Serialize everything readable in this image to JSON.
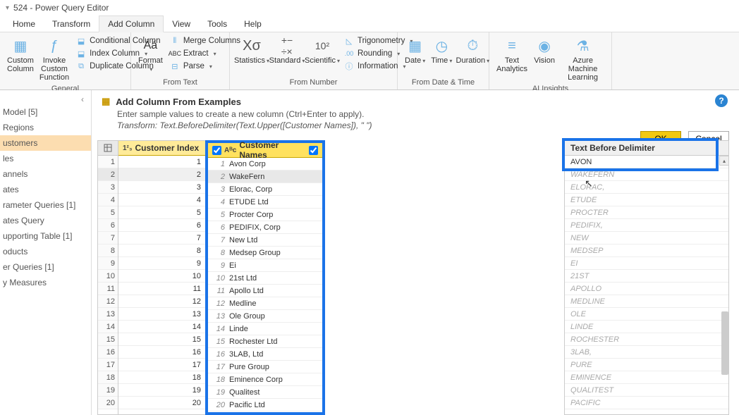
{
  "window_title": "524 - Power Query Editor",
  "menu": [
    "Home",
    "Transform",
    "Add Column",
    "View",
    "Tools",
    "Help"
  ],
  "active_menu": 2,
  "ribbon": {
    "general": {
      "label": "General",
      "custom_column": "Custom\nColumn",
      "invoke": "Invoke Custom\nFunction",
      "conditional": "Conditional Column",
      "index": "Index Column",
      "duplicate": "Duplicate Column"
    },
    "from_text": {
      "label": "From Text",
      "format": "Format",
      "merge": "Merge Columns",
      "extract": "Extract",
      "parse": "Parse"
    },
    "from_number": {
      "label": "From Number",
      "statistics": "Statistics",
      "standard": "Standard",
      "scientific": "Scientific",
      "trig": "Trigonometry",
      "rounding": "Rounding",
      "information": "Information"
    },
    "from_date": {
      "label": "From Date & Time",
      "date": "Date",
      "time": "Time",
      "duration": "Duration"
    },
    "ai": {
      "label": "AI Insights",
      "text_analytics": "Text\nAnalytics",
      "vision": "Vision",
      "azure_ml": "Azure Machine\nLearning"
    }
  },
  "queries": {
    "items": [
      "Model [5]",
      "Regions",
      "ustomers",
      "les",
      "annels",
      "ates",
      "rameter Queries [1]",
      "ates Query",
      "upporting Table [1]",
      "oducts",
      "er Queries [1]",
      "y Measures"
    ],
    "selected_index": 2
  },
  "banner": {
    "title": "Add Column From Examples",
    "subtitle": "Enter sample values to create a new column (Ctrl+Enter to apply).",
    "transform": "Transform: Text.BeforeDelimiter(Text.Upper([Customer Names]), \" \")",
    "ok": "OK",
    "cancel": "Cancel"
  },
  "grid": {
    "col_index": "Customer Index",
    "col_names": "Customer Names",
    "result_header": "Text Before Delimiter",
    "rows": [
      {
        "n": 1,
        "name": "Avon Corp",
        "out": "AVON",
        "filled": true
      },
      {
        "n": 2,
        "name": "WakeFern",
        "out": "WAKEFERN"
      },
      {
        "n": 3,
        "name": "Elorac, Corp",
        "out": "ELORAC,"
      },
      {
        "n": 4,
        "name": "ETUDE Ltd",
        "out": "ETUDE"
      },
      {
        "n": 5,
        "name": "Procter Corp",
        "out": "PROCTER"
      },
      {
        "n": 6,
        "name": "PEDIFIX, Corp",
        "out": "PEDIFIX,"
      },
      {
        "n": 7,
        "name": "New Ltd",
        "out": "NEW"
      },
      {
        "n": 8,
        "name": "Medsep Group",
        "out": "MEDSEP"
      },
      {
        "n": 9,
        "name": "Ei",
        "out": "EI"
      },
      {
        "n": 10,
        "name": "21st Ltd",
        "out": "21ST"
      },
      {
        "n": 11,
        "name": "Apollo Ltd",
        "out": "APOLLO"
      },
      {
        "n": 12,
        "name": "Medline",
        "out": "MEDLINE"
      },
      {
        "n": 13,
        "name": "Ole Group",
        "out": "OLE"
      },
      {
        "n": 14,
        "name": "Linde",
        "out": "LINDE"
      },
      {
        "n": 15,
        "name": "Rochester Ltd",
        "out": "ROCHESTER"
      },
      {
        "n": 16,
        "name": "3LAB, Ltd",
        "out": "3LAB,"
      },
      {
        "n": 17,
        "name": "Pure Group",
        "out": "PURE"
      },
      {
        "n": 18,
        "name": "Eminence Corp",
        "out": "EMINENCE"
      },
      {
        "n": 19,
        "name": "Qualitest",
        "out": "QUALITEST"
      },
      {
        "n": 20,
        "name": "Pacific Ltd",
        "out": "PACIFIC"
      }
    ],
    "selected_row": 2
  }
}
